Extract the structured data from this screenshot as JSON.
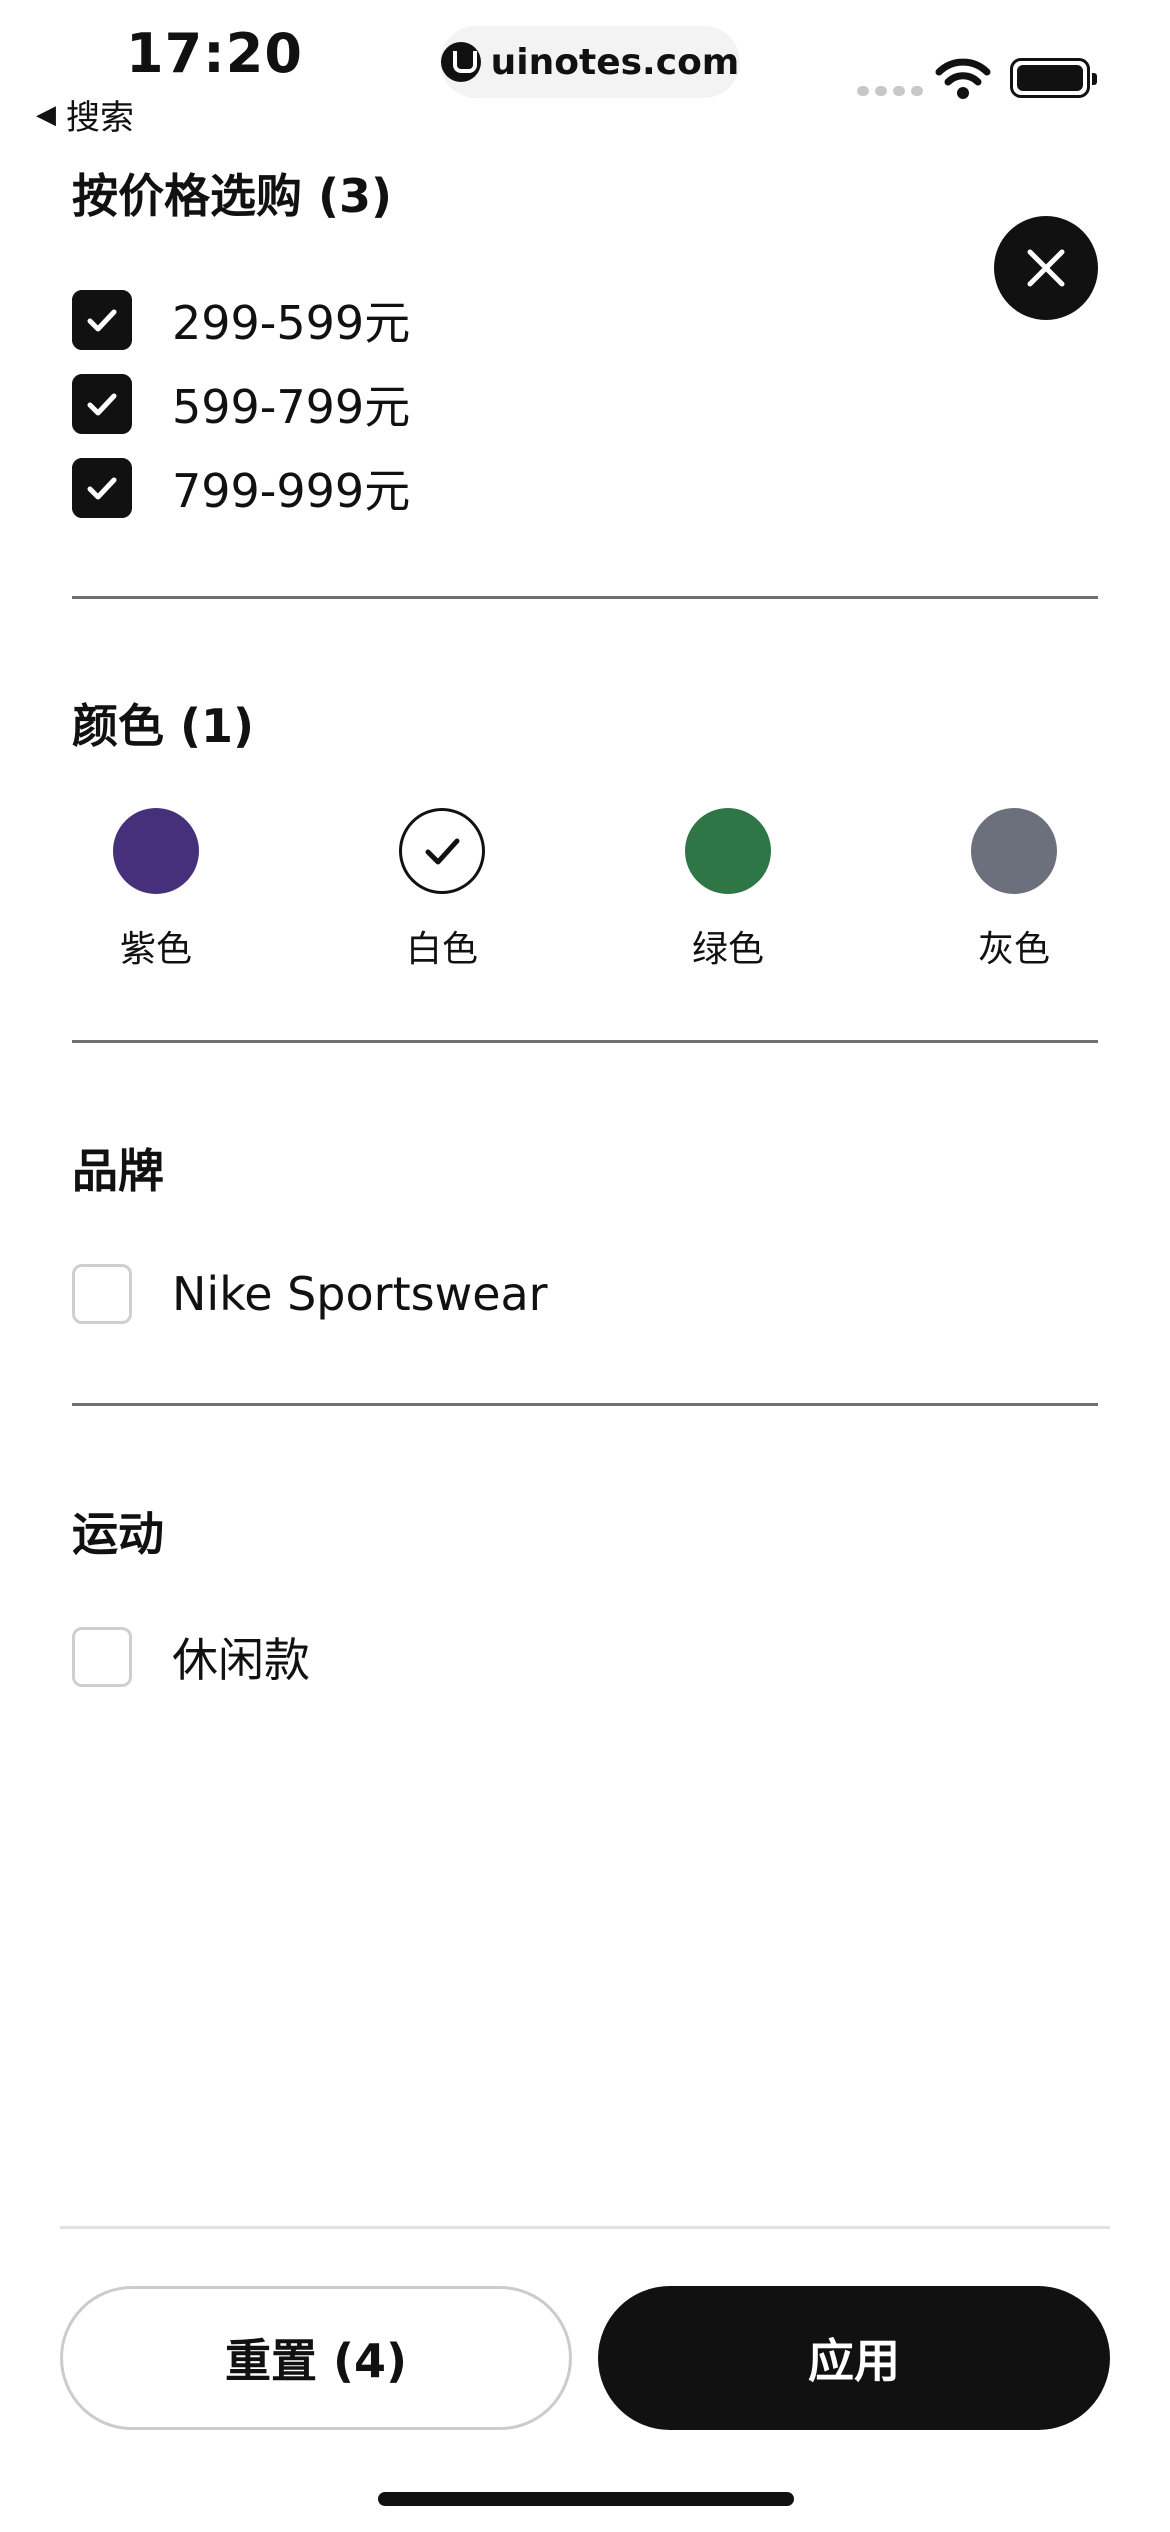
{
  "status_bar": {
    "time": "17:20",
    "back_label": "搜索",
    "back_arrow": "◀",
    "url": "uinotes.com"
  },
  "icons": {
    "close": "close-icon",
    "check": "check-icon",
    "wifi": "wifi-icon",
    "battery": "battery-icon",
    "signal": "cellular-signal-icon",
    "site_logo": "uinotes-logo-icon"
  },
  "price": {
    "title": "按价格选购 (3)",
    "options": [
      {
        "label": "299-599元",
        "checked": true
      },
      {
        "label": "599-799元",
        "checked": true
      },
      {
        "label": "799-999元",
        "checked": true
      }
    ]
  },
  "color": {
    "title": "颜色 (1)",
    "options": [
      {
        "label": "紫色",
        "hex": "#46307C",
        "selected": false
      },
      {
        "label": "白色",
        "hex": "#FFFFFF",
        "selected": true
      },
      {
        "label": "绿色",
        "hex": "#2E7645",
        "selected": false
      },
      {
        "label": "灰色",
        "hex": "#6C707C",
        "selected": false
      }
    ]
  },
  "brand": {
    "title": "品牌",
    "options": [
      {
        "label": "Nike Sportswear",
        "checked": false
      }
    ]
  },
  "sport": {
    "title": "运动",
    "options": [
      {
        "label": "休闲款",
        "checked": false
      }
    ]
  },
  "footer": {
    "reset_label": "重置 (4)",
    "apply_label": "应用"
  },
  "colors": {
    "primary": "#111111",
    "divider": "#707070",
    "background": "#FFFFFF"
  }
}
